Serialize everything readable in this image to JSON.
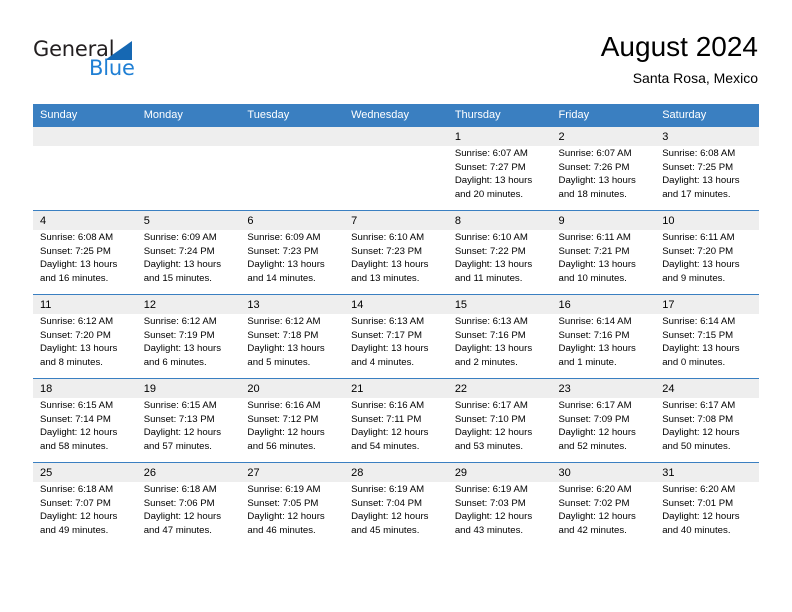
{
  "brand": {
    "name_part1": "General",
    "name_part2": "Blue",
    "triangle_color": "#1668b3",
    "blue_color": "#1f7fd4"
  },
  "header": {
    "title": "August 2024",
    "subtitle": "Santa Rosa, Mexico",
    "header_bg": "#3a7fc1",
    "shade_bg": "#eeeeee"
  },
  "weekdays": [
    "Sunday",
    "Monday",
    "Tuesday",
    "Wednesday",
    "Thursday",
    "Friday",
    "Saturday"
  ],
  "weeks": [
    [
      {
        "day": "",
        "l1": "",
        "l2": "",
        "l3": "",
        "l4": ""
      },
      {
        "day": "",
        "l1": "",
        "l2": "",
        "l3": "",
        "l4": ""
      },
      {
        "day": "",
        "l1": "",
        "l2": "",
        "l3": "",
        "l4": ""
      },
      {
        "day": "",
        "l1": "",
        "l2": "",
        "l3": "",
        "l4": ""
      },
      {
        "day": "1",
        "l1": "Sunrise: 6:07 AM",
        "l2": "Sunset: 7:27 PM",
        "l3": "Daylight: 13 hours",
        "l4": "and 20 minutes."
      },
      {
        "day": "2",
        "l1": "Sunrise: 6:07 AM",
        "l2": "Sunset: 7:26 PM",
        "l3": "Daylight: 13 hours",
        "l4": "and 18 minutes."
      },
      {
        "day": "3",
        "l1": "Sunrise: 6:08 AM",
        "l2": "Sunset: 7:25 PM",
        "l3": "Daylight: 13 hours",
        "l4": "and 17 minutes."
      }
    ],
    [
      {
        "day": "4",
        "l1": "Sunrise: 6:08 AM",
        "l2": "Sunset: 7:25 PM",
        "l3": "Daylight: 13 hours",
        "l4": "and 16 minutes."
      },
      {
        "day": "5",
        "l1": "Sunrise: 6:09 AM",
        "l2": "Sunset: 7:24 PM",
        "l3": "Daylight: 13 hours",
        "l4": "and 15 minutes."
      },
      {
        "day": "6",
        "l1": "Sunrise: 6:09 AM",
        "l2": "Sunset: 7:23 PM",
        "l3": "Daylight: 13 hours",
        "l4": "and 14 minutes."
      },
      {
        "day": "7",
        "l1": "Sunrise: 6:10 AM",
        "l2": "Sunset: 7:23 PM",
        "l3": "Daylight: 13 hours",
        "l4": "and 13 minutes."
      },
      {
        "day": "8",
        "l1": "Sunrise: 6:10 AM",
        "l2": "Sunset: 7:22 PM",
        "l3": "Daylight: 13 hours",
        "l4": "and 11 minutes."
      },
      {
        "day": "9",
        "l1": "Sunrise: 6:11 AM",
        "l2": "Sunset: 7:21 PM",
        "l3": "Daylight: 13 hours",
        "l4": "and 10 minutes."
      },
      {
        "day": "10",
        "l1": "Sunrise: 6:11 AM",
        "l2": "Sunset: 7:20 PM",
        "l3": "Daylight: 13 hours",
        "l4": "and 9 minutes."
      }
    ],
    [
      {
        "day": "11",
        "l1": "Sunrise: 6:12 AM",
        "l2": "Sunset: 7:20 PM",
        "l3": "Daylight: 13 hours",
        "l4": "and 8 minutes."
      },
      {
        "day": "12",
        "l1": "Sunrise: 6:12 AM",
        "l2": "Sunset: 7:19 PM",
        "l3": "Daylight: 13 hours",
        "l4": "and 6 minutes."
      },
      {
        "day": "13",
        "l1": "Sunrise: 6:12 AM",
        "l2": "Sunset: 7:18 PM",
        "l3": "Daylight: 13 hours",
        "l4": "and 5 minutes."
      },
      {
        "day": "14",
        "l1": "Sunrise: 6:13 AM",
        "l2": "Sunset: 7:17 PM",
        "l3": "Daylight: 13 hours",
        "l4": "and 4 minutes."
      },
      {
        "day": "15",
        "l1": "Sunrise: 6:13 AM",
        "l2": "Sunset: 7:16 PM",
        "l3": "Daylight: 13 hours",
        "l4": "and 2 minutes."
      },
      {
        "day": "16",
        "l1": "Sunrise: 6:14 AM",
        "l2": "Sunset: 7:16 PM",
        "l3": "Daylight: 13 hours",
        "l4": "and 1 minute."
      },
      {
        "day": "17",
        "l1": "Sunrise: 6:14 AM",
        "l2": "Sunset: 7:15 PM",
        "l3": "Daylight: 13 hours",
        "l4": "and 0 minutes."
      }
    ],
    [
      {
        "day": "18",
        "l1": "Sunrise: 6:15 AM",
        "l2": "Sunset: 7:14 PM",
        "l3": "Daylight: 12 hours",
        "l4": "and 58 minutes."
      },
      {
        "day": "19",
        "l1": "Sunrise: 6:15 AM",
        "l2": "Sunset: 7:13 PM",
        "l3": "Daylight: 12 hours",
        "l4": "and 57 minutes."
      },
      {
        "day": "20",
        "l1": "Sunrise: 6:16 AM",
        "l2": "Sunset: 7:12 PM",
        "l3": "Daylight: 12 hours",
        "l4": "and 56 minutes."
      },
      {
        "day": "21",
        "l1": "Sunrise: 6:16 AM",
        "l2": "Sunset: 7:11 PM",
        "l3": "Daylight: 12 hours",
        "l4": "and 54 minutes."
      },
      {
        "day": "22",
        "l1": "Sunrise: 6:17 AM",
        "l2": "Sunset: 7:10 PM",
        "l3": "Daylight: 12 hours",
        "l4": "and 53 minutes."
      },
      {
        "day": "23",
        "l1": "Sunrise: 6:17 AM",
        "l2": "Sunset: 7:09 PM",
        "l3": "Daylight: 12 hours",
        "l4": "and 52 minutes."
      },
      {
        "day": "24",
        "l1": "Sunrise: 6:17 AM",
        "l2": "Sunset: 7:08 PM",
        "l3": "Daylight: 12 hours",
        "l4": "and 50 minutes."
      }
    ],
    [
      {
        "day": "25",
        "l1": "Sunrise: 6:18 AM",
        "l2": "Sunset: 7:07 PM",
        "l3": "Daylight: 12 hours",
        "l4": "and 49 minutes."
      },
      {
        "day": "26",
        "l1": "Sunrise: 6:18 AM",
        "l2": "Sunset: 7:06 PM",
        "l3": "Daylight: 12 hours",
        "l4": "and 47 minutes."
      },
      {
        "day": "27",
        "l1": "Sunrise: 6:19 AM",
        "l2": "Sunset: 7:05 PM",
        "l3": "Daylight: 12 hours",
        "l4": "and 46 minutes."
      },
      {
        "day": "28",
        "l1": "Sunrise: 6:19 AM",
        "l2": "Sunset: 7:04 PM",
        "l3": "Daylight: 12 hours",
        "l4": "and 45 minutes."
      },
      {
        "day": "29",
        "l1": "Sunrise: 6:19 AM",
        "l2": "Sunset: 7:03 PM",
        "l3": "Daylight: 12 hours",
        "l4": "and 43 minutes."
      },
      {
        "day": "30",
        "l1": "Sunrise: 6:20 AM",
        "l2": "Sunset: 7:02 PM",
        "l3": "Daylight: 12 hours",
        "l4": "and 42 minutes."
      },
      {
        "day": "31",
        "l1": "Sunrise: 6:20 AM",
        "l2": "Sunset: 7:01 PM",
        "l3": "Daylight: 12 hours",
        "l4": "and 40 minutes."
      }
    ]
  ]
}
